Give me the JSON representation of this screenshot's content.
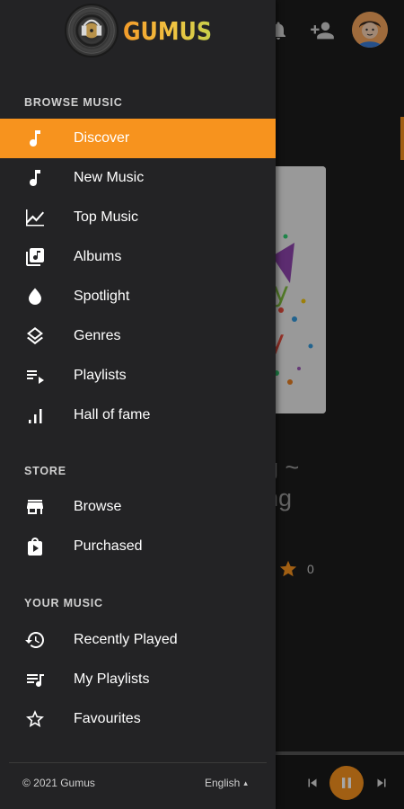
{
  "app": {
    "logo_text": "GUMUS"
  },
  "drawer": {
    "sections": [
      {
        "header": "BROWSE MUSIC",
        "items": [
          {
            "label": "Discover",
            "icon": "music-note-double-icon",
            "active": true
          },
          {
            "label": "New Music",
            "icon": "music-note-icon"
          },
          {
            "label": "Top Music",
            "icon": "trending-chart-icon"
          },
          {
            "label": "Albums",
            "icon": "album-library-icon"
          },
          {
            "label": "Spotlight",
            "icon": "drop-icon"
          },
          {
            "label": "Genres",
            "icon": "layers-icon"
          },
          {
            "label": "Playlists",
            "icon": "playlist-play-icon"
          },
          {
            "label": "Hall of fame",
            "icon": "bar-chart-icon"
          }
        ]
      },
      {
        "header": "STORE",
        "items": [
          {
            "label": "Browse",
            "icon": "store-icon"
          },
          {
            "label": "Purchased",
            "icon": "shopping-bag-icon"
          }
        ]
      },
      {
        "header": "YOUR MUSIC",
        "items": [
          {
            "label": "Recently Played",
            "icon": "history-icon"
          },
          {
            "label": "My Playlists",
            "icon": "queue-music-icon"
          },
          {
            "label": "Favourites",
            "icon": "star-outline-icon"
          }
        ]
      }
    ],
    "footer": {
      "copyright": "© 2021 Gumus",
      "language": "English",
      "language_caret": "▴"
    }
  },
  "background": {
    "song_title_fragment_line1": "ng ~",
    "song_title_fragment_line2": "ung",
    "rating_count": "0"
  },
  "colors": {
    "accent": "#f7931e",
    "drawer_bg": "#232325",
    "app_bg": "#1c1c1c"
  }
}
